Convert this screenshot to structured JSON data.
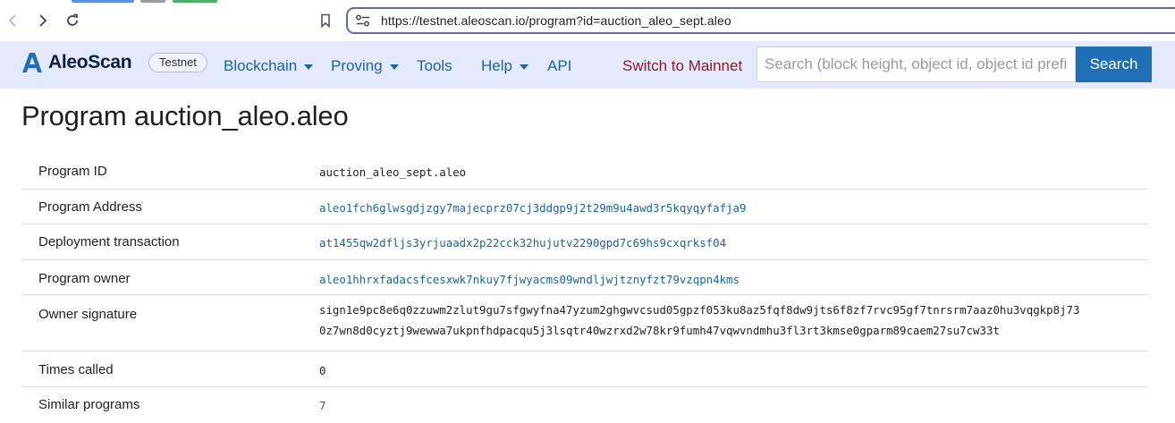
{
  "browser": {
    "url": "https://testnet.aleoscan.io/program?id=auction_aleo_sept.aleo"
  },
  "header": {
    "brand": "AleoScan",
    "network_badge": "Testnet",
    "nav": {
      "blockchain": "Blockchain",
      "proving": "Proving",
      "tools": "Tools",
      "help": "Help",
      "api": "API"
    },
    "switch_network": "Switch to Mainnet",
    "search": {
      "placeholder": "Search (block height, object id, object id prefix)",
      "button": "Search"
    }
  },
  "page": {
    "title": "Program auction_aleo.aleo"
  },
  "details": {
    "program_id": {
      "label": "Program ID",
      "value": "auction_aleo_sept.aleo"
    },
    "program_address": {
      "label": "Program Address",
      "value": "aleo1fch6glwsgdjzgy7majecprz07cj3ddgp9j2t29m9u4awd3r5kqyqyfafja9"
    },
    "deployment_transaction": {
      "label": "Deployment transaction",
      "value": "at1455qw2dfljs3yrjuaadx2p22cck32hujutv2290gpd7c69hs9cxqrksf04"
    },
    "program_owner": {
      "label": "Program owner",
      "value": "aleo1hhrxfadacsfcesxwk7nkuy7fjwyacms09wndljwjtznyfzt79vzqpn4kms"
    },
    "owner_signature": {
      "label": "Owner signature",
      "line1": "sign1e9pc8e6q0zzuwm2zlut9gu7sfgwyfna47yzum2ghgwvcsud05gpzf053ku8az5fqf8dw9jts6f8zf7rvc95gf7tnrsrm7aaz0hu3vqgkp8j73",
      "line2": "0z7wn8d0cyztj9wewwa7ukpnfhdpacqu5j3lsqtr40wzrxd2w78kr9fumh47vqwvndmhu3fl3rt3kmse0gparm89caem27su7cw33t"
    },
    "times_called": {
      "label": "Times called",
      "value": "0"
    },
    "similar_programs": {
      "label": "Similar programs",
      "value": "7"
    }
  }
}
